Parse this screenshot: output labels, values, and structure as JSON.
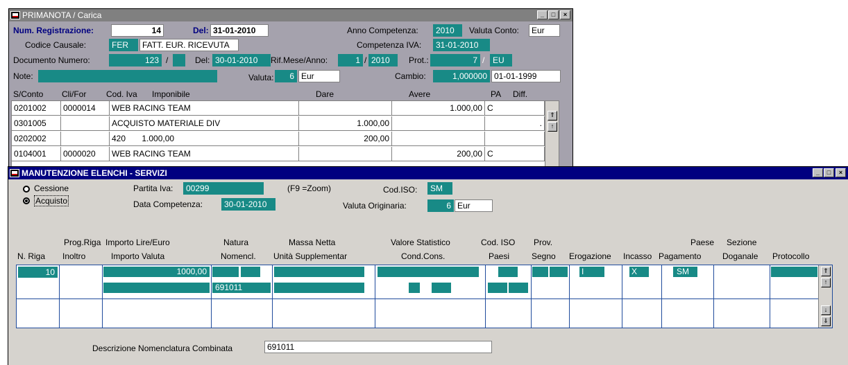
{
  "win1": {
    "title": "PRIMANOTA / Carica",
    "num_reg_label": "Num. Registrazione:",
    "num_reg": "14",
    "del_label": "Del:",
    "del": "31-01-2010",
    "anno_comp_label": "Anno Competenza:",
    "anno_comp": "2010",
    "valuta_conto_label": "Valuta Conto:",
    "valuta_conto": "Eur",
    "causale_label": "Codice Causale:",
    "causale_code": "FER",
    "causale_desc": "FATT. EUR. RICEVUTA",
    "comp_iva_label": "Competenza IVA:",
    "comp_iva": "31-01-2010",
    "doc_num_label": "Documento Numero:",
    "doc_num": "123",
    "slash": "/",
    "doc_del_label": "Del:",
    "doc_del": "30-01-2010",
    "rif_label": "Rif.Mese/Anno:",
    "rif_mese": "1",
    "rif_slash": "/",
    "rif_anno": "2010",
    "prot_label": "Prot.:",
    "prot": "7",
    "prot_slash": "/",
    "prot_suffix": "EU",
    "note_label": "Note:",
    "valuta_label": "Valuta:",
    "valuta_code": "6",
    "valuta": "Eur",
    "cambio_label": "Cambio:",
    "cambio": "1,000000",
    "cambio_date": "01-01-1999",
    "headers": {
      "sconto": "S/Conto",
      "clifor": "Cli/For",
      "codiva": "Cod. Iva",
      "imponibile": "Imponibile",
      "dare": "Dare",
      "avere": "Avere",
      "pa": "PA",
      "diff": "Diff."
    },
    "rows": [
      {
        "sconto": "0201002",
        "clifor": "0000014",
        "desc": "WEB RACING TEAM",
        "dare": "",
        "avere": "1.000,00",
        "pa": "C",
        "diff": ""
      },
      {
        "sconto": "0301005",
        "clifor": "",
        "desc": "ACQUISTO MATERIALE DIV",
        "dare": "1.000,00",
        "avere": "",
        "pa": "",
        "diff": "."
      },
      {
        "sconto": "0202002",
        "clifor": "",
        "desc": "420       1.000,00",
        "dare": "200,00",
        "avere": "",
        "pa": "",
        "diff": ""
      },
      {
        "sconto": "0104001",
        "clifor": "0000020",
        "desc": "WEB RACING TEAM",
        "dare": "",
        "avere": "200,00",
        "pa": "C",
        "diff": ""
      }
    ]
  },
  "win2": {
    "title": "MANUTENZIONE ELENCHI - SERVIZI",
    "cessione": "Cessione",
    "acquisto": "Acquisto",
    "piva_label": "Partita Iva:",
    "piva": "00299",
    "zoom": "(F9 =Zoom)",
    "codiso_label": "Cod.ISO:",
    "codiso": "SM",
    "data_comp_label": "Data Competenza:",
    "data_comp": "30-01-2010",
    "valuta_orig_label": "Valuta Originaria:",
    "valuta_orig_code": "6",
    "valuta_orig": "Eur",
    "headers": {
      "nriga": "N. Riga",
      "prog1": "Prog.Riga",
      "prog2": "Inoltro",
      "imp1": "Importo Lire/Euro",
      "imp2": "Importo Valuta",
      "nat1": "Natura",
      "nat2": "Nomencl.",
      "massa1": "Massa Netta",
      "massa2": "Unità Supplementar",
      "val1": "Valore Statistico",
      "val2": "Cond.Cons.",
      "iso1": "Cod. ISO",
      "iso2": "Paesi",
      "prov1": "Prov.",
      "prov2": "Segno",
      "erog": "Erogazione",
      "incasso": "Incasso",
      "paese1": "Paese",
      "paese2": "Pagamento",
      "sez1": "Sezione",
      "sez2": "Doganale",
      "prot": "Protocollo"
    },
    "row": {
      "nriga": "10",
      "importo": "1000,00",
      "natura": "691011",
      "erog": "I",
      "incasso": "X",
      "paese": "SM"
    },
    "desc_label": "Descrizione Nomenclatura Combinata",
    "desc": "691011"
  }
}
